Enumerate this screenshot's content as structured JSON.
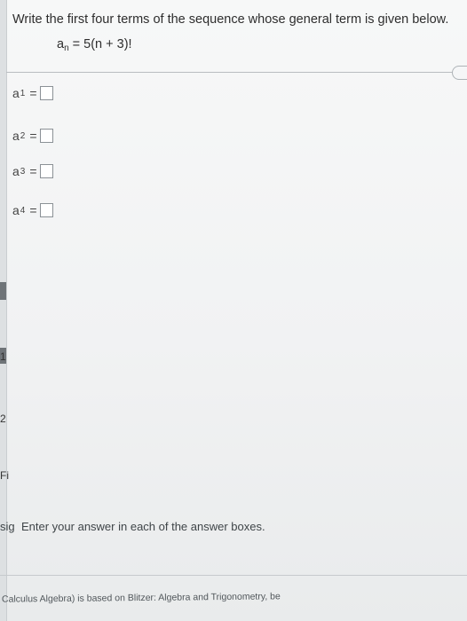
{
  "question": {
    "prompt": "Write the first four terms of the sequence whose general term is given below.",
    "formula": {
      "lhs_base": "a",
      "lhs_sub": "n",
      "rhs": "= 5(n + 3)!"
    }
  },
  "terms": [
    {
      "base": "a",
      "sub": "1",
      "eq": "=",
      "value": ""
    },
    {
      "base": "a",
      "sub": "2",
      "eq": "=",
      "value": ""
    },
    {
      "base": "a",
      "sub": "3",
      "eq": "=",
      "value": ""
    },
    {
      "base": "a",
      "sub": "4",
      "eq": "=",
      "value": ""
    }
  ],
  "left_rail": {
    "letters": [
      "1",
      "2",
      "Fi",
      "sig"
    ]
  },
  "hint": "Enter your answer in each of the answer boxes.",
  "footer": "Calculus Algebra) is based on Blitzer: Algebra and Trigonometry, be"
}
